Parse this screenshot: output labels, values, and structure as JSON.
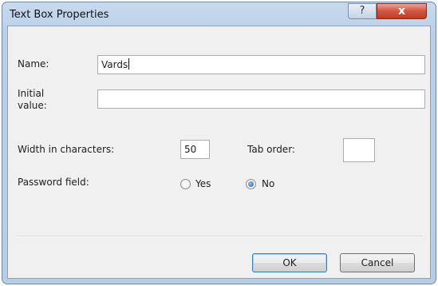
{
  "dialog": {
    "title": "Text Box Properties",
    "help_glyph": "?",
    "close_glyph": "x"
  },
  "form": {
    "name_label": "Name:",
    "name_value": "Vards",
    "initial_value_label_line1": "Initial",
    "initial_value_label_line2": "value:",
    "initial_value": "",
    "width_label": "Width in characters:",
    "width_value": "50",
    "tab_order_label": "Tab order:",
    "tab_order_value": "",
    "password_label": "Password field:",
    "password_options": [
      {
        "label": "Yes",
        "checked": false
      },
      {
        "label": "No",
        "checked": true
      }
    ]
  },
  "buttons": {
    "ok_label": "OK",
    "cancel_label": "Cancel"
  },
  "colors": {
    "frame": "#b9cfe6",
    "client": "#f0f0f0",
    "close_button": "#c23b23",
    "default_button_border": "#3c7fb1"
  }
}
